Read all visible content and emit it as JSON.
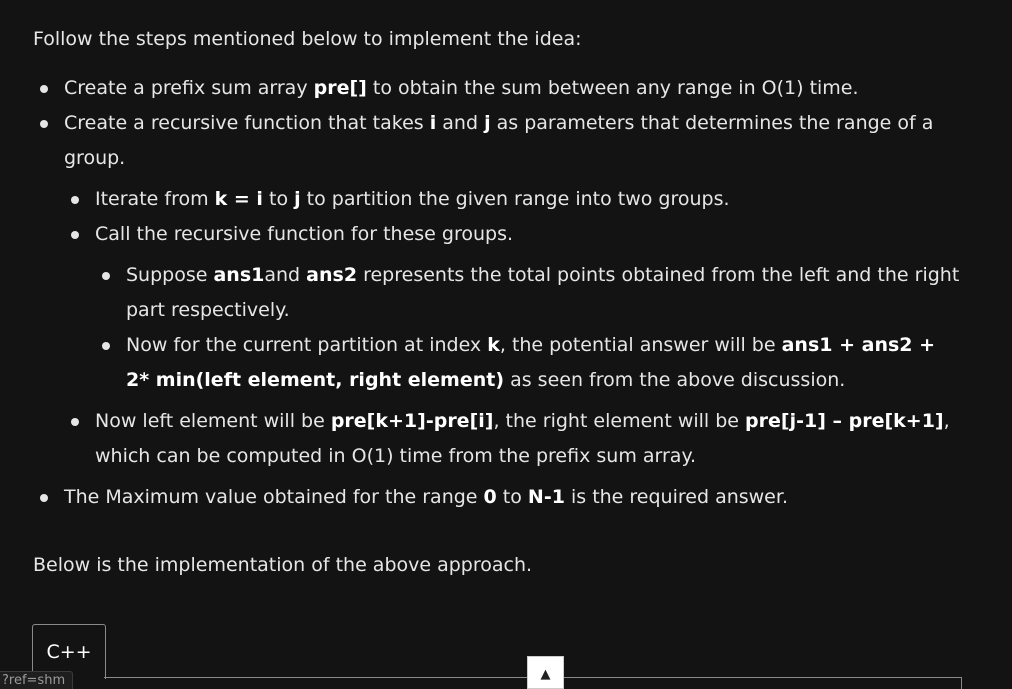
{
  "intro": "Follow the steps mentioned below to implement the idea:",
  "steps": {
    "s1": {
      "t1": "Create a prefix sum array ",
      "b1": "pre[]",
      "t2": " to obtain the sum between any range in O(1) time."
    },
    "s2": {
      "t1": "Create a recursive function that takes ",
      "b1": "i",
      "t2": " and ",
      "b2": "j",
      "t3": " as parameters that determines the range of a group.",
      "sub": {
        "s1": {
          "t1": "Iterate from ",
          "b1": "k = i",
          "t2": " to ",
          "b2": "j",
          "t3": " to partition the given range into two groups."
        },
        "s2": {
          "t1": "Call the recursive function for these groups.",
          "sub": {
            "s1": {
              "t1": "Suppose ",
              "b1": "ans1",
              "t2": "and ",
              "b2": "ans2",
              "t3": " represents the total points obtained from the left and the right part respectively."
            },
            "s2": {
              "t1": "Now for the current partition at index ",
              "b1": "k",
              "t2": ", the potential answer will be ",
              "b2": "ans1 + ans2 + 2* min(left element, right element)",
              "t3": " as seen from the above discussion."
            }
          }
        },
        "s3": {
          "t1": "Now left element will be ",
          "b1": "pre[k+1]-pre[i]",
          "t2": ", the right element will be ",
          "b2": "pre[j-1] – pre[k+1]",
          "t3": ", which can be computed in O(1) time from the prefix sum array."
        }
      }
    },
    "s3": {
      "t1": "The Maximum value obtained for the range ",
      "b1": "0",
      "t2": " to ",
      "b2": "N-1",
      "t3": " is the required answer."
    }
  },
  "below": "Below is the implementation of the above approach.",
  "code_tab_label": "C++",
  "scroll_top_glyph": "▲",
  "url_hint": "?ref=shm"
}
